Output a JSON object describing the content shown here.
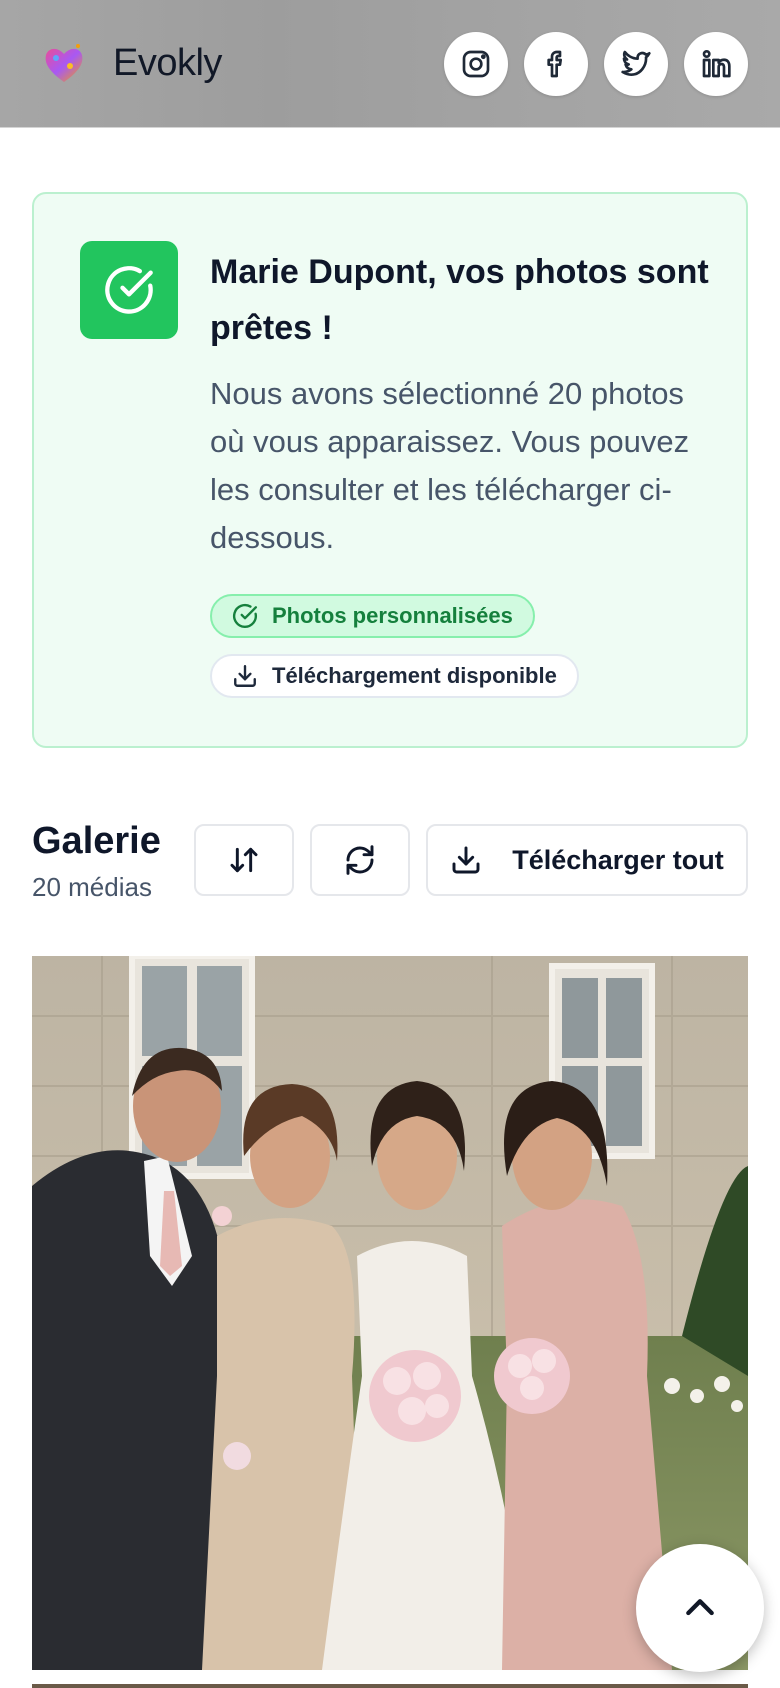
{
  "header": {
    "brand": "Evokly",
    "icons": {
      "logo": "heart-logo-icon",
      "instagram": "instagram-icon",
      "facebook": "facebook-icon",
      "twitter": "twitter-icon",
      "linkedin": "linkedin-icon"
    }
  },
  "notice": {
    "title": "Marie Dupont, vos photos sont prêtes !",
    "text": "Nous avons sélectionné 20 photos où vous apparaissez. Vous pouvez les consulter et les télécharger ci-dessous.",
    "badges": [
      {
        "label": "Photos personnalisées",
        "icon": "check-circle-icon"
      },
      {
        "label": "Téléchargement disponible",
        "icon": "download-icon"
      }
    ]
  },
  "gallery": {
    "title": "Galerie",
    "count": "20 médias",
    "download_all": "Télécharger tout",
    "photo_alt": "Photo de mariage : famille avec la mariée devant un château"
  },
  "colors": {
    "accent_green": "#22c55e",
    "card_bg": "#effcf4",
    "text_dark": "#0f172a"
  }
}
